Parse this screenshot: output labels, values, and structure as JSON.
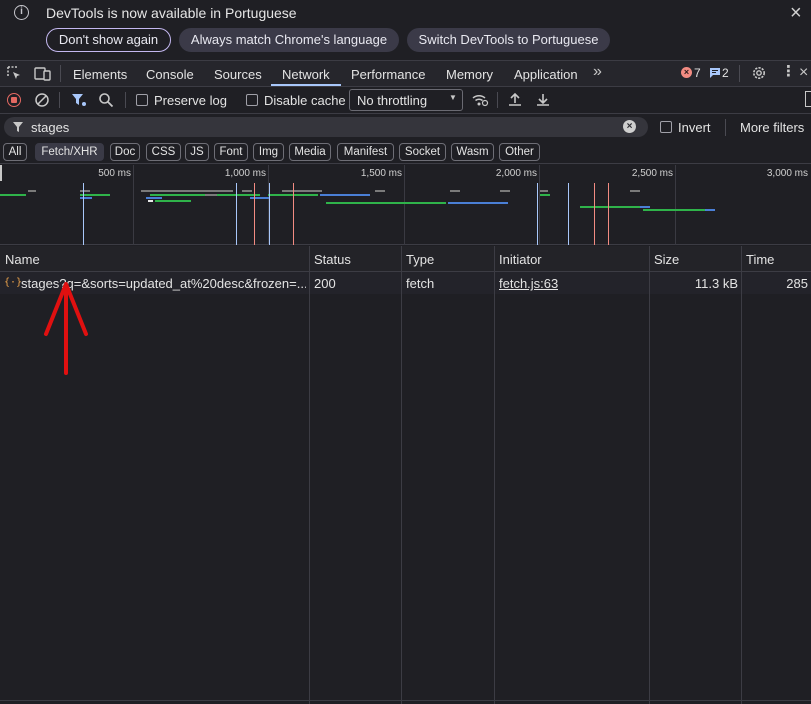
{
  "infobar": {
    "message": "DevTools is now available in Portuguese",
    "buttons": [
      "Don't show again",
      "Always match Chrome's language",
      "Switch DevTools to Portuguese"
    ]
  },
  "tabs": {
    "items": [
      "Elements",
      "Console",
      "Sources",
      "Network",
      "Performance",
      "Memory",
      "Application"
    ],
    "active": "Network",
    "errors_count": "7",
    "messages_count": "2"
  },
  "toolbar": {
    "preserve_log": "Preserve log",
    "disable_cache": "Disable cache",
    "throttling": "No throttling"
  },
  "filter": {
    "value": "stages",
    "invert": "Invert",
    "more_filters": "More filters"
  },
  "type_filters": {
    "items": [
      "All",
      "Fetch/XHR",
      "Doc",
      "CSS",
      "JS",
      "Font",
      "Img",
      "Media",
      "Manifest",
      "Socket",
      "Wasm",
      "Other"
    ],
    "active": "Fetch/XHR"
  },
  "timeline": {
    "ticks": [
      "500 ms",
      "1,000 ms",
      "1,500 ms",
      "2,000 ms",
      "2,500 ms",
      "3,000 ms"
    ]
  },
  "table": {
    "columns": [
      "Name",
      "Status",
      "Type",
      "Initiator",
      "Size",
      "Time"
    ],
    "rows": [
      {
        "name": "stages?q=&sorts=updated_at%20desc&frozen=...",
        "status": "200",
        "type": "fetch",
        "initiator": "fetch.js:63",
        "size": "11.3 kB",
        "time": "285"
      }
    ]
  },
  "colors": {
    "accent": "#a8c7fa",
    "annotation_arrow": "#e01010",
    "error_badge": "#f28b82",
    "record_button": "#e46962"
  }
}
